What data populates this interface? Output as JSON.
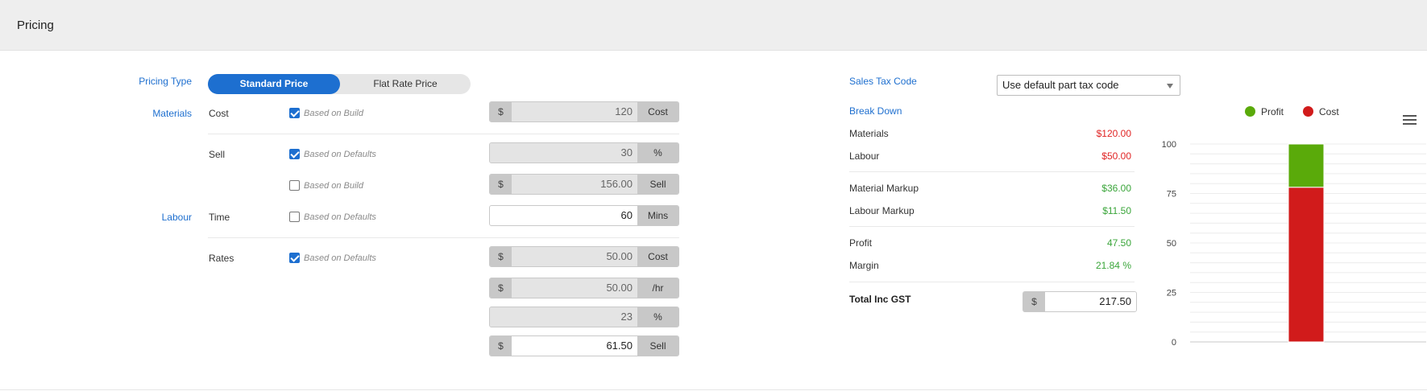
{
  "header": {
    "title": "Pricing"
  },
  "pricing_type": {
    "label": "Pricing Type",
    "options": [
      "Standard Price",
      "Flat Rate Price"
    ],
    "selected": "Standard Price"
  },
  "materials": {
    "label": "Materials",
    "cost": {
      "label": "Cost",
      "checkbox_checked": true,
      "checkbox_label": "Based on Build",
      "prefix": "$",
      "value": "120",
      "suffix": "Cost"
    },
    "sell": {
      "label": "Sell",
      "checkbox_checked": true,
      "checkbox_label": "Based on Defaults",
      "value": "30",
      "suffix": "%"
    },
    "sell_build": {
      "checkbox_checked": false,
      "checkbox_label": "Based on Build",
      "prefix": "$",
      "value": "156.00",
      "suffix": "Sell"
    }
  },
  "labour": {
    "label": "Labour",
    "time": {
      "label": "Time",
      "checkbox_checked": false,
      "checkbox_label": "Based on Defaults",
      "value": "60",
      "suffix": "Mins"
    },
    "rates": {
      "label": "Rates",
      "checkbox_checked": true,
      "checkbox_label": "Based on Defaults",
      "prefix": "$",
      "value": "50.00",
      "suffix": "Cost"
    },
    "per_hr": {
      "prefix": "$",
      "value": "50.00",
      "suffix": "/hr"
    },
    "markup": {
      "value": "23",
      "suffix": "%"
    },
    "sell": {
      "prefix": "$",
      "value": "61.50",
      "suffix": "Sell"
    }
  },
  "sales_tax": {
    "label": "Sales Tax Code",
    "selected": "Use default part tax code"
  },
  "breakdown": {
    "label": "Break Down",
    "materials": {
      "label": "Materials",
      "value": "$120.00"
    },
    "labour": {
      "label": "Labour",
      "value": "$50.00"
    },
    "material_markup": {
      "label": "Material Markup",
      "value": "$36.00"
    },
    "labour_markup": {
      "label": "Labour Markup",
      "value": "$11.50"
    },
    "profit": {
      "label": "Profit",
      "value": "47.50"
    },
    "margin": {
      "label": "Margin",
      "value": "21.84 %"
    },
    "total": {
      "label": "Total Inc GST",
      "prefix": "$",
      "value": "217.50"
    }
  },
  "colors": {
    "accent": "#1d6fd0",
    "profit": "#5aaa0a",
    "cost": "#d11b1b",
    "cost_text": "#e02424",
    "profit_text": "#3aa53a"
  },
  "chart_data": {
    "type": "bar",
    "stacked": true,
    "categories": [
      ""
    ],
    "series": [
      {
        "name": "Profit",
        "values": [
          21.84
        ],
        "color": "#5aaa0a"
      },
      {
        "name": "Cost",
        "values": [
          78.16
        ],
        "color": "#d11b1b"
      }
    ],
    "ylim": [
      0,
      100
    ],
    "yticks": [
      "100",
      "75",
      "50",
      "25",
      "0"
    ],
    "legend": "top",
    "grid": true
  }
}
